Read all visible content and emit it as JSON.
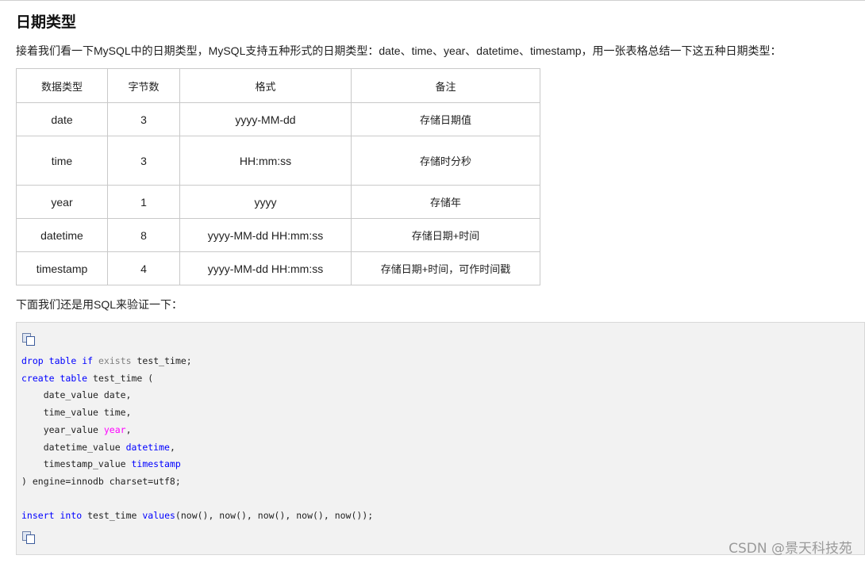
{
  "heading": "日期类型",
  "intro": "接着我们看一下MySQL中的日期类型，MySQL支持五种形式的日期类型：date、time、year、datetime、timestamp，用一张表格总结一下这五种日期类型：",
  "table": {
    "headers": [
      "数据类型",
      "字节数",
      "格式",
      "备注"
    ],
    "rows": [
      [
        "date",
        "3",
        "yyyy-MM-dd",
        "存储日期值"
      ],
      [
        "time",
        "3",
        "HH:mm:ss",
        "存储时分秒"
      ],
      [
        "year",
        "1",
        "yyyy",
        "存储年"
      ],
      [
        "datetime",
        "8",
        "yyyy-MM-dd HH:mm:ss",
        "存储日期+时间"
      ],
      [
        "timestamp",
        "4",
        "yyyy-MM-dd HH:mm:ss",
        "存储日期+时间，可作时间戳"
      ]
    ]
  },
  "outro": "下面我们还是用SQL来验证一下：",
  "code": {
    "line1": {
      "a": "drop",
      "b": "table",
      "c": "if",
      "d": "exists",
      "e": "test_time;"
    },
    "line2": {
      "a": "create",
      "b": "table",
      "c": "test_time ("
    },
    "line3": "    date_value date,",
    "line4": "    time_value time,",
    "line5": {
      "a": "    year_value ",
      "b": "year",
      "c": ","
    },
    "line6": {
      "a": "    datetime_value ",
      "b": "datetime",
      "c": ","
    },
    "line7": {
      "a": "    timestamp_value ",
      "b": "timestamp"
    },
    "line8": ") engine=innodb charset=utf8;",
    "line10": {
      "a": "insert",
      "b": "into",
      "c": "test_time ",
      "d": "values",
      "e": "(now(), now(), now(), now(), now());"
    }
  },
  "watermark": "CSDN @景天科技苑"
}
